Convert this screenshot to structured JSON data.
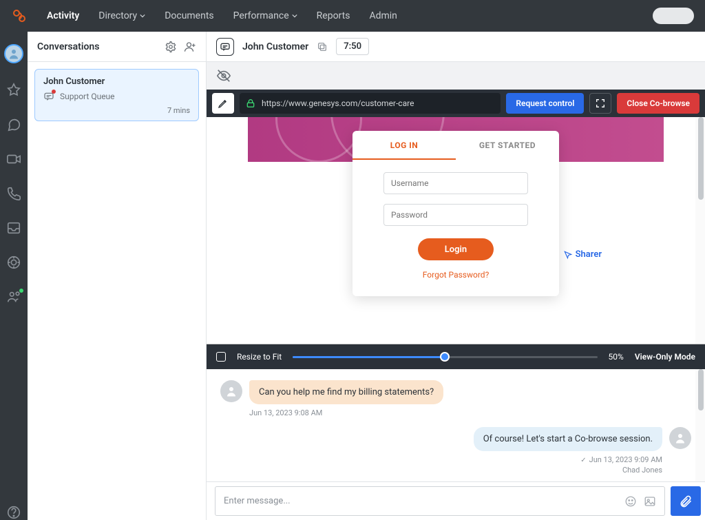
{
  "nav": {
    "items": [
      "Activity",
      "Directory",
      "Documents",
      "Performance",
      "Reports",
      "Admin"
    ],
    "activeIndex": 0
  },
  "conversations": {
    "title": "Conversations",
    "card": {
      "name": "John Customer",
      "queue": "Support Queue",
      "time": "7 mins"
    }
  },
  "header": {
    "name": "John Customer",
    "timer": "7:50"
  },
  "cobrowse": {
    "url": "https://www.genesys.com/customer-care",
    "request_btn": "Request control",
    "close_btn": "Close Co-browse",
    "resize_label": "Resize to Fit",
    "zoom_pct": "50%",
    "mode": "View-Only Mode",
    "sharer_label": "Sharer"
  },
  "login_card": {
    "tab_login": "LOG IN",
    "tab_getstarted": "GET STARTED",
    "username_ph": "Username",
    "password_ph": "Password",
    "login_btn": "Login",
    "forgot": "Forgot Password?"
  },
  "chat": {
    "msg_in": "Can you help me find my billing statements?",
    "ts_in": "Jun 13, 2023 9:08 AM",
    "msg_out": "Of course! Let's start a Co-browse session.",
    "ts_out": "Jun 13, 2023 9:09 AM",
    "agent_name": "Chad Jones"
  },
  "composer": {
    "placeholder": "Enter message..."
  }
}
